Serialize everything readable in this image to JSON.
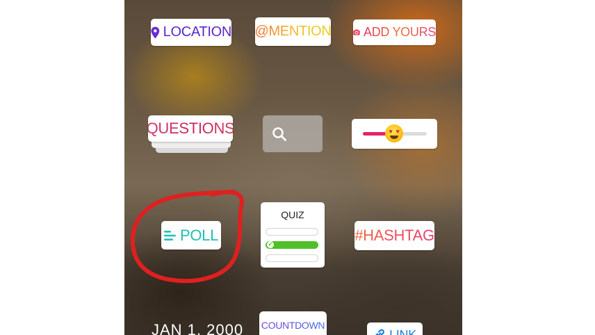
{
  "stickers": {
    "location": {
      "label": "LOCATION",
      "icon": "map-pin-icon",
      "color": "#5a26c9"
    },
    "mention": {
      "label": "@MENTION"
    },
    "add_yours": {
      "label": "ADD YOURS",
      "icon": "camera-icon"
    },
    "questions": {
      "label": "QUESTIONS"
    },
    "search": {
      "icon": "search-icon"
    },
    "emoji_slider": {
      "icon": "heart-eyes-emoji-icon",
      "accent": "#e6246a",
      "level": 0.4
    },
    "poll": {
      "label": "POLL",
      "icon": "poll-lines-icon",
      "color": "#1fbfb4"
    },
    "quiz": {
      "title": "QUIZ",
      "options_count": 3,
      "correct_index": 1,
      "correct_color": "#4fc02a"
    },
    "hashtag": {
      "label": "#HASHTAG"
    },
    "date": {
      "label": "JAN 1, 2000"
    },
    "countdown": {
      "label": "COUNTDOWN"
    },
    "link": {
      "label": "LINK",
      "icon": "link-icon"
    }
  },
  "annotation": {
    "color": "#e02020"
  }
}
